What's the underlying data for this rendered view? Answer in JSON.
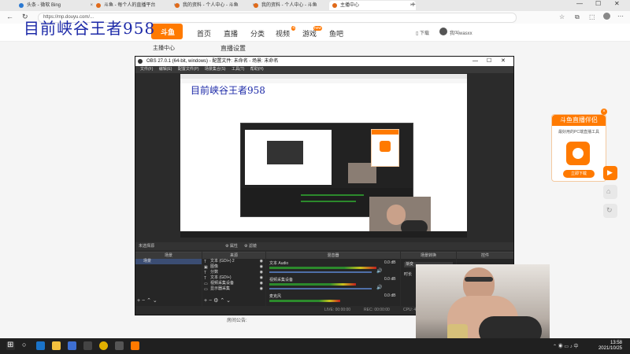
{
  "overlay": {
    "title": "目前峡谷王者958"
  },
  "browser": {
    "tabs": [
      {
        "label": "头条 - 微软 Bing"
      },
      {
        "label": "斗鱼 - 每个人的直播平台"
      },
      {
        "label": "我的资料 - 个人中心 - 斗鱼"
      },
      {
        "label": "我的资料 - 个人中心 - 斗鱼"
      },
      {
        "label": "主播中心"
      }
    ],
    "url": "https://mp.douyu.com/..."
  },
  "site": {
    "logo_text": "斗鱼",
    "nav": [
      "首页",
      "直播",
      "分类",
      "视频",
      "游戏",
      "鱼吧"
    ],
    "nav_badges": {
      "视频": "4",
      "游戏": "new"
    },
    "download": "下载",
    "user": "我叫wasxx"
  },
  "page": {
    "left_heading": "主播中心",
    "section_heading": "直播设置",
    "bottom_label": "房间公告:"
  },
  "promo": {
    "title": "斗鱼直播伴侣",
    "desc": "最好用的PC端直播工具",
    "button": "立即下载"
  },
  "obs": {
    "title": "OBS 27.0.1 (64-bit, windows) - 配置文件: 未命名 - 场景: 未命名",
    "menu": [
      "文件(F)",
      "编辑(E)",
      "配置文件(P)",
      "场景集合(S)",
      "工具(T)",
      "帮助(H)"
    ],
    "preview_title": "目前峡谷王者958",
    "toolbar": {
      "status": "未选择源",
      "props": "属性",
      "filters": "滤镜"
    },
    "docks": {
      "scenes": "场景",
      "sources": "来源",
      "mixer": "混音器",
      "transitions": "场景转换",
      "controls": "控件"
    },
    "scene_item": "场景",
    "sources": [
      {
        "icon": "T",
        "name": "文本 (GDI+) 2"
      },
      {
        "icon": "▣",
        "name": "图像"
      },
      {
        "icon": "T",
        "name": "分数"
      },
      {
        "icon": "T",
        "name": "文本 (GDI+)"
      },
      {
        "icon": "▭",
        "name": "视频采集设备"
      },
      {
        "icon": "▭",
        "name": "显示器采集"
      }
    ],
    "mixer": [
      {
        "name": "文本 Audio",
        "db": "0.0 dB"
      },
      {
        "name": "视频采集设备",
        "db": "0.0 dB"
      },
      {
        "name": "麦克风",
        "db": "0.0 dB"
      }
    ],
    "transition": "渐变",
    "duration": "时长",
    "status": {
      "live": "00:00:00",
      "rec": "00:00:00",
      "cpu": "CPU: 4.0%, 30.00 fps",
      "live_label": "LIVE:",
      "rec_label": "REC:"
    }
  },
  "taskbar": {
    "time": "13:58",
    "date": "2021/10/25"
  },
  "colors": {
    "brand": "#ff7a00",
    "overlay_text": "#1d2aa8"
  }
}
